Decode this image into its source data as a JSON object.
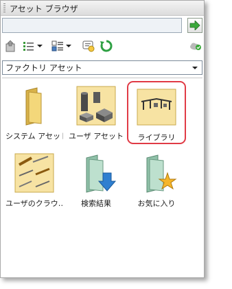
{
  "panel": {
    "title": "アセット ブラウザ"
  },
  "search": {
    "value": "",
    "placeholder": ""
  },
  "toolbar": {
    "buttons": [
      {
        "icon": "parent-folder-icon"
      },
      {
        "icon": "list-view-icon"
      },
      {
        "icon": "display-options-icon"
      },
      {
        "icon": "tip-icon"
      },
      {
        "icon": "refresh-icon"
      },
      {
        "icon": "cloud-sync-icon"
      }
    ]
  },
  "category": {
    "selected": "ファクトリ アセット"
  },
  "tiles": [
    {
      "label": "システム アセット",
      "icon": "folder-icon",
      "selected": false
    },
    {
      "label": "ユーザ アセット",
      "icon": "assets-folder-icon",
      "selected": false
    },
    {
      "label": "ライブラリ",
      "icon": "library-folder-icon",
      "selected": true
    },
    {
      "label": "ユーザのクラウ…",
      "icon": "cloud-folder-icon",
      "selected": false
    },
    {
      "label": "検索結果",
      "icon": "search-results-folder-icon",
      "selected": false
    },
    {
      "label": "お気に入り",
      "icon": "favorites-folder-icon",
      "selected": false
    }
  ],
  "colors": {
    "selection_border": "#e03a45",
    "go_arrow": "#3aa83a",
    "refresh": "#2ea043",
    "folder": "#f3d77a"
  }
}
